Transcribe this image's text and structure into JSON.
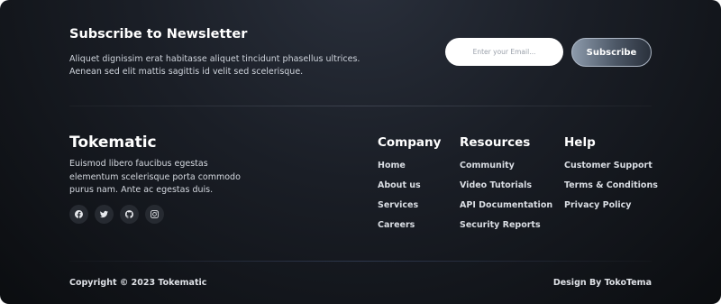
{
  "newsletter": {
    "title": "Subscribe to Newsletter",
    "description": "Aliquet dignissim erat habitasse aliquet tincidunt phasellus ultrices. Aenean sed elit mattis sagittis id velit sed scelerisque.",
    "email_placeholder": "Enter your Email...",
    "subscribe_label": "Subscribe"
  },
  "brand": {
    "name": "Tokematic",
    "description": "Euismod libero faucibus egestas elementum scelerisque porta commodo purus nam. Ante ac egestas duis."
  },
  "socials": [
    "facebook-icon",
    "twitter-icon",
    "github-icon",
    "instagram-icon"
  ],
  "columns": {
    "company": {
      "title": "Company",
      "links": [
        "Home",
        "About us",
        "Services",
        "Careers"
      ]
    },
    "resources": {
      "title": "Resources",
      "links": [
        "Community",
        "Video Tutorials",
        "API Documentation",
        "Security Reports"
      ]
    },
    "help": {
      "title": "Help",
      "links": [
        "Customer Support",
        "Terms & Conditions",
        "Privacy Policy"
      ]
    }
  },
  "bottom": {
    "copyright": "Copyright © 2023 Tokematic",
    "credit": "Design By TokoTema"
  },
  "colors": {
    "background": "#0b0d10",
    "button_gradient_start": "#8c9aab",
    "button_gradient_end": "#2a313c",
    "text": "#ffffff"
  }
}
